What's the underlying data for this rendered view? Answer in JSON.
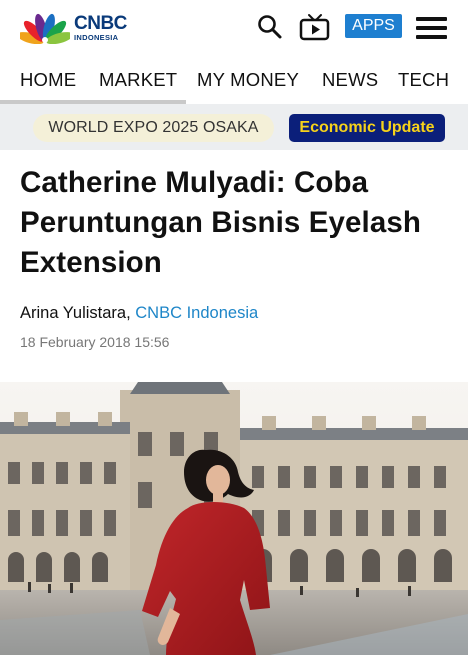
{
  "brand": {
    "name": "CNBC",
    "sub": "INDONESIA"
  },
  "header": {
    "apps_label": "APPS",
    "icons": [
      "search-icon",
      "tv-icon",
      "menu-icon"
    ]
  },
  "nav": {
    "items": [
      "HOME",
      "MARKET",
      "MY MONEY",
      "NEWS",
      "TECH"
    ],
    "active": "HOME"
  },
  "tags": {
    "expo": "WORLD EXPO 2025 OSAKA",
    "econ": "Economic Update"
  },
  "article": {
    "title": "Catherine Mulyadi: Coba Peruntungan Bisnis Eyelash Extension",
    "author": "Arina Yulistara",
    "source": "CNBC Indonesia",
    "date": "18 February 2018 15:56"
  },
  "colors": {
    "accent": "#1e7fd0",
    "source_link": "#1e86c8",
    "econ_bg": "#0b1f7a",
    "econ_text": "#f6d21a",
    "expo_bg": "#f4f0d8",
    "tagbar_bg": "#eceef0"
  }
}
